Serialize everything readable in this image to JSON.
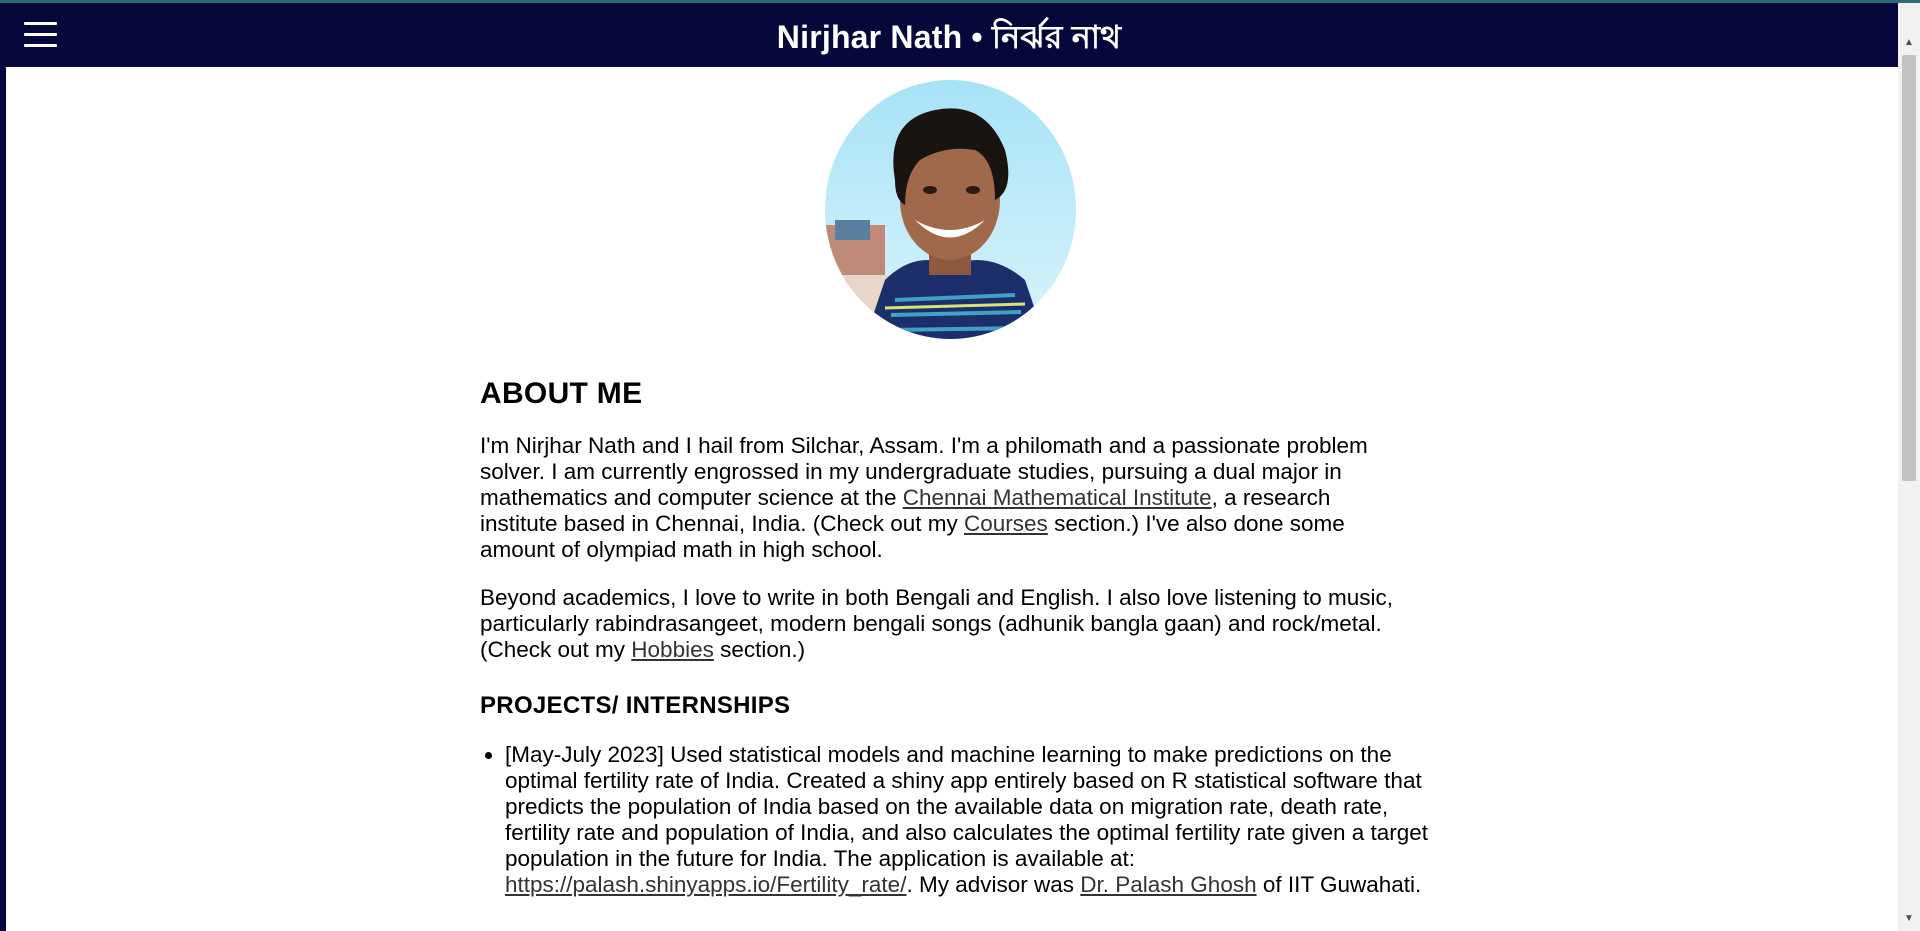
{
  "header": {
    "title": "Nirjhar Nath • নির্ঝর নাথ",
    "menu_icon": "hamburger-menu-icon"
  },
  "profile": {
    "photo_description": "profile-photo"
  },
  "about": {
    "heading": "ABOUT ME",
    "para1": {
      "t1": "I'm Nirjhar Nath and I hail from Silchar, Assam. I'm a philomath and a passionate problem solver. I am currently engrossed in my undergraduate studies, pursuing a dual major in mathematics and computer science at the ",
      "link1": "Chennai Mathematical Institute",
      "t2": ", a research institute based in Chennai, India. (Check out my ",
      "link2": "Courses",
      "t3": " section.) I've also done some amount of olympiad math in high school."
    },
    "para2": {
      "t1": "Beyond academics, I love to write in both Bengali and English. I also love listening to music, particularly rabindrasangeet, modern bengali songs (adhunik bangla gaan) and rock/metal. (Check out my ",
      "link1": "Hobbies",
      "t2": " section.)"
    }
  },
  "projects": {
    "heading": "PROJECTS/ INTERNSHIPS",
    "items": [
      {
        "t1": "[May-July 2023] Used statistical models and machine learning to make predictions on the optimal fertility rate of India. Created a shiny app entirely based on R statistical software that predicts the population of India based on the available data on migration rate, death rate, fertility rate and population of India, and also calculates the optimal fertility rate given a target population in the future for India. The application is available at: ",
        "link1": "https://palash.shinyapps.io/Fertility_rate/",
        "t2": ". My advisor was ",
        "link2": "Dr. Palash Ghosh",
        "t3": " of IIT Guwahati."
      }
    ]
  },
  "colors": {
    "header_bg": "#06073a",
    "content_bg": "#ffffff",
    "link": "#333333"
  }
}
